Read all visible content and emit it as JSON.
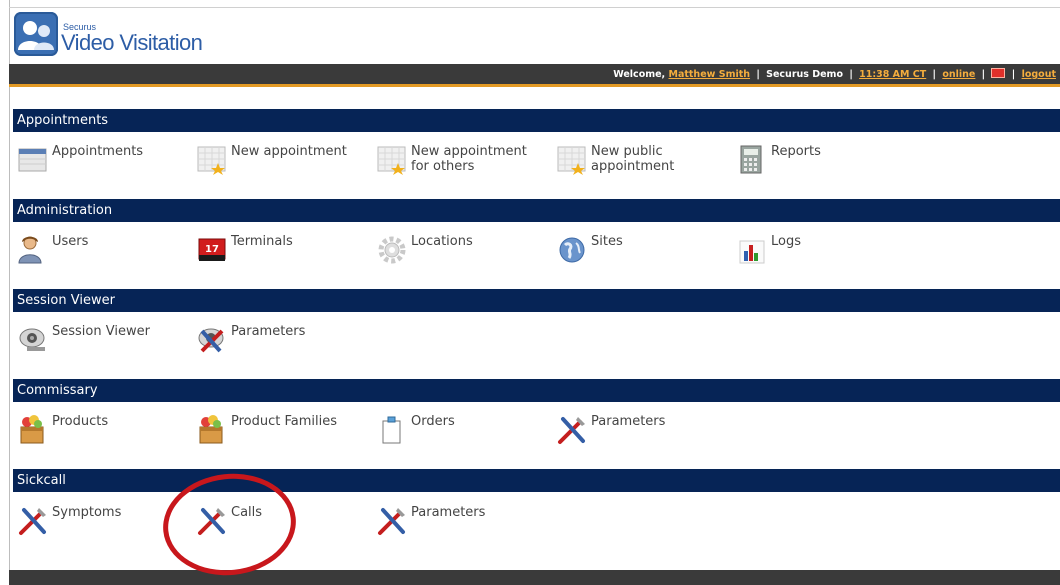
{
  "app": {
    "brand_small": "Securus",
    "brand_title": "Video Visitation"
  },
  "topbar": {
    "welcome_prefix": "Welcome, ",
    "user_name": "Matthew Smith",
    "org": "Securus Demo",
    "time": "11:38 AM CT",
    "status": "online",
    "logout": "logout",
    "separator": "|"
  },
  "sections": {
    "appointments": {
      "title": "Appointments",
      "items": [
        "Appointments",
        "New appointment",
        "New appointment\nfor others",
        "New public\nappointment",
        "Reports"
      ]
    },
    "administration": {
      "title": "Administration",
      "items": [
        "Users",
        "Terminals",
        "Locations",
        "Sites",
        "Logs"
      ]
    },
    "session_viewer": {
      "title": "Session Viewer",
      "items": [
        "Session Viewer",
        "Parameters"
      ]
    },
    "commissary": {
      "title": "Commissary",
      "items": [
        "Products",
        "Product Families",
        "Orders",
        "Parameters"
      ]
    },
    "sickcall": {
      "title": "Sickcall",
      "items": [
        "Symptoms",
        "Calls",
        "Parameters"
      ]
    }
  },
  "icons": {
    "terminal_badge": "17"
  },
  "colors": {
    "section_header_bg": "#062456",
    "topbar_bg": "#3a3a3a",
    "topbar_accent": "#e39a25",
    "link_color": "#f4ad3d",
    "highlight_circle": "#c8171c",
    "brand_blue": "#2d5da6"
  }
}
